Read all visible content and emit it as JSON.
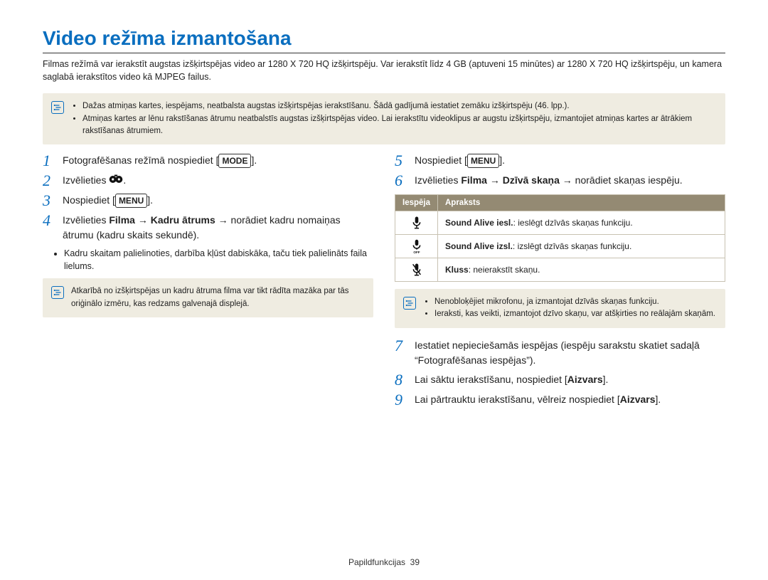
{
  "title": "Video režīma izmantošana",
  "intro": "Filmas režīmā var ierakstīt augstas izšķirtspējas video ar 1280 X 720 HQ izšķirtspēju. Var ierakstīt līdz 4 GB (aptuveni 15 minūtes) ar 1280 X 720 HQ izšķirtspēju, un kamera saglabā ierakstītos video kā MJPEG failus.",
  "top_note": {
    "items": [
      "Dažas atmiņas kartes, iespējams, neatbalsta augstas izšķirtspējas ierakstīšanu. Šādā gadījumā iestatiet zemāku izšķirtspēju (46. lpp.).",
      "Atmiņas kartes ar lēnu rakstīšanas ātrumu neatbalstīs augstas izšķirtspējas video. Lai ierakstītu videoklipus ar augstu izšķirtspēju, izmantojiet atmiņas kartes ar ātrākiem rakstīšanas ātrumiem."
    ]
  },
  "steps_left": {
    "s1": {
      "num": "1",
      "pre": "Fotografēšanas režīmā nospiediet ",
      "btn": "MODE",
      "post": "."
    },
    "s2": {
      "num": "2",
      "pre": "Izvēlieties ",
      "post": "."
    },
    "s3": {
      "num": "3",
      "pre": "Nospiediet ",
      "btn": "MENU",
      "post": "."
    },
    "s4": {
      "num": "4",
      "line1_a": "Izvēlieties ",
      "line1_b": "Filma",
      "line1_c": " → ",
      "line1_d": "Kadru ātrums",
      "line1_e": " → norādiet kadru nomaiņas ātrumu (kadru skaits sekundē).",
      "bullets": [
        "Kadru skaitam palielinoties, darbība kļūst dabiskāka, taču tiek palielināts faila lielums."
      ]
    },
    "note4": "Atkarībā no izšķirtspējas un kadru ātruma filma var tikt rādīta mazāka par tās oriģinālo izmēru, kas redzams galvenajā displejā."
  },
  "steps_right": {
    "s5": {
      "num": "5",
      "pre": "Nospiediet ",
      "btn": "MENU",
      "post": "."
    },
    "s6": {
      "num": "6",
      "line_a": "Izvēlieties ",
      "line_b": "Filma",
      "line_c": " → ",
      "line_d": "Dzīvā skaņa",
      "line_e": " → norādiet skaņas iespēju."
    },
    "table": {
      "col1": "Iespēja",
      "col2": "Apraksts",
      "rows": [
        {
          "icon": "mic-on",
          "label_b": "Sound Alive iesl.",
          "label_rest": ": ieslēgt dzīvās skaņas funkciju."
        },
        {
          "icon": "mic-off",
          "label_b": "Sound Alive izsl.",
          "label_rest": ": izslēgt dzīvās skaņas funkciju."
        },
        {
          "icon": "mic-mute",
          "label_b": "Kluss",
          "label_rest": ": neierakstīt skaņu."
        }
      ]
    },
    "note6": {
      "items": [
        "Nenobloķējiet mikrofonu, ja izmantojat dzīvās skaņas funkciju.",
        "Ieraksti, kas veikti, izmantojot dzīvo skaņu, var atšķirties no reālajām skaņām."
      ]
    },
    "s7": {
      "num": "7",
      "text": "Iestatiet nepieciešamās iespējas (iespēju sarakstu skatiet sadaļā “Fotografēšanas iespējas”)."
    },
    "s8": {
      "num": "8",
      "pre": "Lai sāktu ierakstīšanu, nospiediet [",
      "b": "Aizvars",
      "post": "]."
    },
    "s9": {
      "num": "9",
      "pre": "Lai pārtrauktu ierakstīšanu, vēlreiz nospiediet [",
      "b": "Aizvars",
      "post": "]."
    }
  },
  "footer": {
    "section": "Papildfunkcijas",
    "page": "39"
  }
}
